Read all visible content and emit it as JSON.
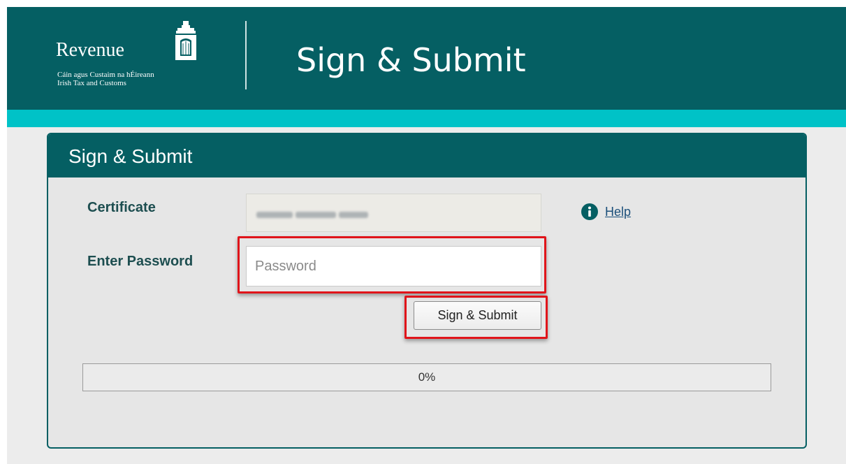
{
  "header": {
    "logo": {
      "wordmark": "Revenue",
      "line1": "Cáin agus Custaim na hÉireann",
      "line2": "Irish Tax and Customs"
    },
    "title": "Sign & Submit"
  },
  "panel": {
    "title": "Sign & Submit",
    "certificate": {
      "label": "Certificate"
    },
    "help": {
      "label": "Help",
      "icon": "info-icon"
    },
    "password": {
      "label": "Enter Password",
      "placeholder": "Password",
      "value": ""
    },
    "submit_label": "Sign & Submit",
    "progress": {
      "value": 0,
      "text": "0%"
    }
  },
  "colors": {
    "header_bg": "#055f63",
    "accent_strip": "#00c2c7",
    "panel_bg": "#e6e6e6",
    "highlight": "#e0141a",
    "label_text": "#1d4e50",
    "link": "#1b4f7a"
  }
}
